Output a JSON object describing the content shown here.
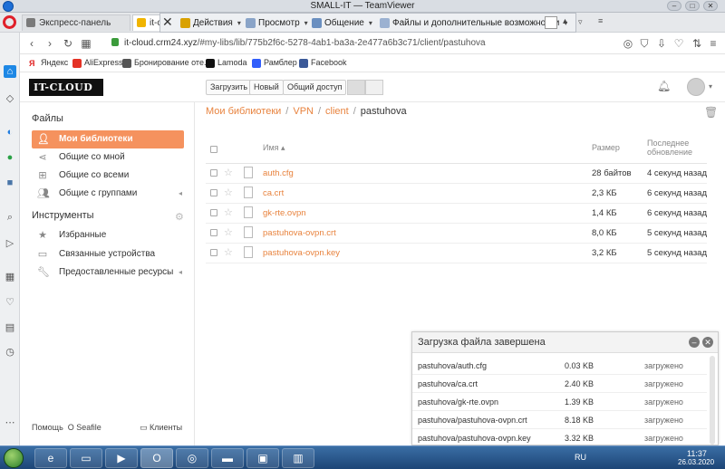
{
  "teamviewer": {
    "title": "SMALL-IT — TeamViewer",
    "toolbar": {
      "actions": "Действия",
      "view": "Просмотр",
      "communicate": "Общение",
      "files": "Файлы и дополнительные возможности"
    }
  },
  "browser": {
    "tabs": [
      {
        "label": "Экспресс-панель"
      },
      {
        "label": "it-c"
      }
    ],
    "url_host": "it-cloud.crm24.xyz",
    "url_path": "/#my-libs/lib/775b2f6c-5278-4ab1-ba3a-2e477a6b3c71/client/pastuhova",
    "bookmarks": [
      "Яндекс",
      "AliExpress",
      "Бронирование оте...",
      "Lamoda",
      "Рамблер",
      "Facebook"
    ]
  },
  "seafile": {
    "logo": "IT-CLOUD",
    "header_buttons": {
      "upload": "Загрузить",
      "new": "Новый",
      "share": "Общий доступ"
    },
    "nav": {
      "files_heading": "Файлы",
      "items": [
        {
          "label": "Мои библиотеки"
        },
        {
          "label": "Общие со мной"
        },
        {
          "label": "Общие со всеми"
        },
        {
          "label": "Общие с группами"
        }
      ],
      "tools_heading": "Инструменты",
      "tools": [
        {
          "label": "Избранные"
        },
        {
          "label": "Связанные устройства"
        },
        {
          "label": "Предоставленные ресурсы"
        }
      ],
      "footer_help": "Помощь",
      "footer_about": "О Seafile",
      "footer_clients": "Клиенты"
    },
    "breadcrumb": [
      "Мои библиотеки",
      "VPN",
      "client",
      "pastuhova"
    ],
    "table": {
      "col_name": "Имя ▴",
      "col_size": "Размер",
      "col_modified_1": "Последнее",
      "col_modified_2": "обновление",
      "rows": [
        {
          "name": "auth.cfg",
          "size": "28 байтов",
          "modified": "4 секунд назад"
        },
        {
          "name": "ca.crt",
          "size": "2,3 КБ",
          "modified": "6 секунд назад"
        },
        {
          "name": "gk-rte.ovpn",
          "size": "1,4 КБ",
          "modified": "6 секунд назад"
        },
        {
          "name": "pastuhova-ovpn.crt",
          "size": "8,0 КБ",
          "modified": "5 секунд назад"
        },
        {
          "name": "pastuhova-ovpn.key",
          "size": "3,2 КБ",
          "modified": "5 секунд назад"
        }
      ]
    },
    "upload_panel": {
      "title": "Загрузка файла завершена",
      "rows": [
        {
          "name": "pastuhova/auth.cfg",
          "size": "0.03 KB",
          "status": "загружено"
        },
        {
          "name": "pastuhova/ca.crt",
          "size": "2.40 KB",
          "status": "загружено"
        },
        {
          "name": "pastuhova/gk-rte.ovpn",
          "size": "1.39 KB",
          "status": "загружено"
        },
        {
          "name": "pastuhova/pastuhova-ovpn.crt",
          "size": "8.18 KB",
          "status": "загружено"
        },
        {
          "name": "pastuhova/pastuhova-ovpn.key",
          "size": "3.32 KB",
          "status": "загружено"
        }
      ]
    }
  },
  "taskbar": {
    "lang": "RU",
    "time": "11:37",
    "date": "26.03.2020"
  },
  "colors": {
    "accent": "#e8833e",
    "nav_active": "#f5925e"
  }
}
